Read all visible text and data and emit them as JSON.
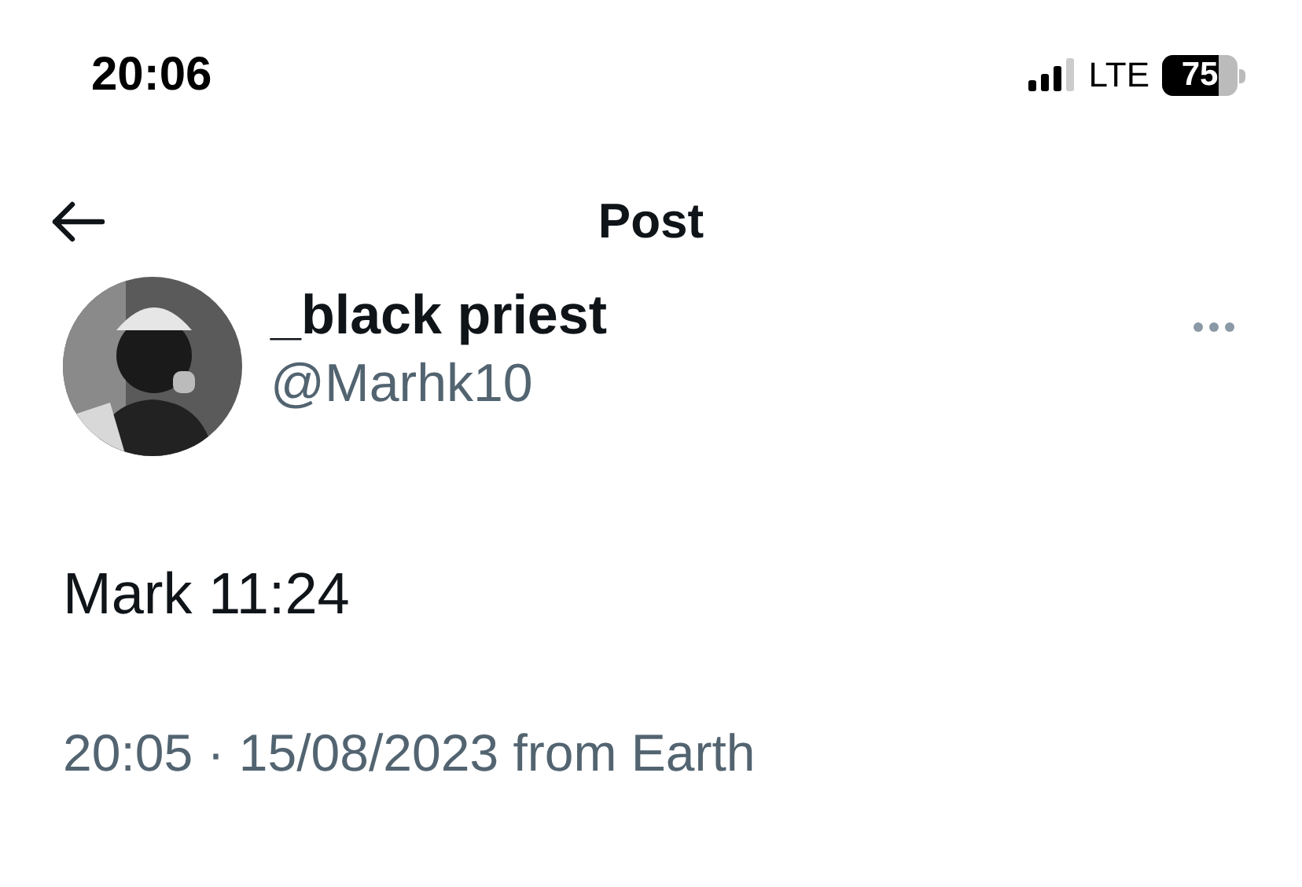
{
  "status_bar": {
    "time": "20:06",
    "network": "LTE",
    "battery": {
      "label": "75",
      "level": 0.75
    }
  },
  "header": {
    "title": "Post"
  },
  "post": {
    "author": {
      "name": "_black priest",
      "handle": "@Marhk10"
    },
    "text": "Mark 11:24",
    "meta": "20:05 · 15/08/2023 from Earth"
  }
}
